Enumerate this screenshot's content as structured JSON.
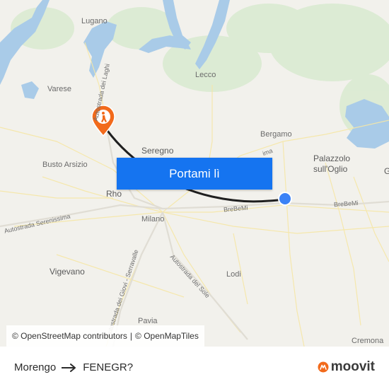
{
  "map": {
    "places": {
      "lugano": "Lugano",
      "varese": "Varese",
      "lecco": "Lecco",
      "bergamo": "Bergamo",
      "palazzolo": "Palazzolo\nsull'Oglio",
      "seregno": "Seregno",
      "busto": "Busto Arsizio",
      "rho": "Rho",
      "milano": "Milano",
      "vigevano": "Vigevano",
      "lodi": "Lodi",
      "pavia": "Pavia",
      "cremona": "Cremona",
      "g_edge": "G"
    },
    "roads": {
      "laghi": "Autostrada dei Laghi",
      "serenissima": "Autostrada Serenissima",
      "brebemi_1": "BreBeMi",
      "brebemi_2": "BreBeMi",
      "giovi": "Autostrada dei Giovi - Serravalle",
      "sole": "Autostrada del Sole",
      "lima": "ima"
    },
    "colors": {
      "route": "#1f1f1f",
      "origin_dot": "#3b82f6",
      "destination_pin": "#f26a1b",
      "water": "#a9cbe8"
    }
  },
  "cta": {
    "label": "Portami lì"
  },
  "attribution": {
    "osm": "© OpenStreetMap contributors",
    "sep": "|",
    "omt": "© OpenMapTiles"
  },
  "footer": {
    "origin": "Morengo",
    "destination": "FENEGR?",
    "arrow_icon": "arrow-right-icon",
    "logo_text": "moovit",
    "logo_icon": "moovit-logo-icon"
  }
}
